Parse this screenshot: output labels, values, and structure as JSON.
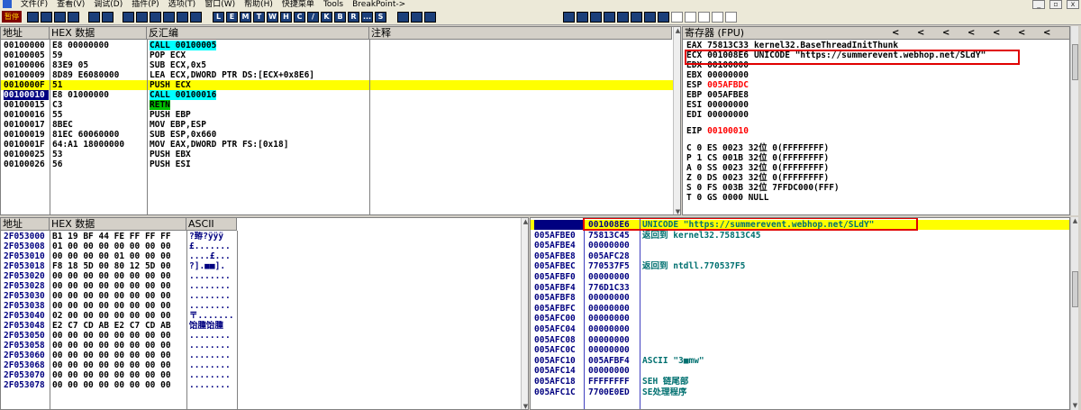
{
  "menu": [
    "暂停",
    "文件(F)",
    "查看(V)",
    "调试(D)",
    "插件(P)",
    "选项(T)",
    "窗口(W)",
    "帮助(H)",
    "快捷菜单",
    "Tools",
    "BreakPoint->"
  ],
  "window_controls": [
    "_",
    "▫",
    "x"
  ],
  "toolbar": {
    "pause_label": "暂停",
    "letters": [
      "L",
      "E",
      "M",
      "T",
      "W",
      "H",
      "C",
      "/",
      "K",
      "B",
      "R",
      "...",
      "S"
    ]
  },
  "disasm": {
    "headers": {
      "addr": "地址",
      "hex": "HEX 数据",
      "asm": "反汇编",
      "comment": "注释"
    },
    "rows": [
      {
        "addr": "00100000",
        "hex": "E8 00000000",
        "asm": "CALL 00100005",
        "kind": "call"
      },
      {
        "addr": "00100005",
        "hex": "59",
        "asm": "POP ECX",
        "kind": ""
      },
      {
        "addr": "00100006",
        "hex": "83E9 05",
        "asm": "SUB ECX,0x5",
        "kind": ""
      },
      {
        "addr": "00100009",
        "hex": "8D89 E6080000",
        "asm": "LEA ECX,DWORD PTR DS:[ECX+0x8E6]",
        "kind": ""
      },
      {
        "addr": "0010000F",
        "hex": "51",
        "asm": "PUSH ECX",
        "kind": "hl"
      },
      {
        "addr": "00100010",
        "hex": "E8 01000000",
        "asm": "CALL 00100016",
        "kind": "eip"
      },
      {
        "addr": "00100015",
        "hex": "C3",
        "asm": "RETN",
        "kind": "retn"
      },
      {
        "addr": "00100016",
        "hex": "55",
        "asm": "PUSH EBP",
        "kind": ""
      },
      {
        "addr": "00100017",
        "hex": "8BEC",
        "asm": "MOV EBP,ESP",
        "kind": ""
      },
      {
        "addr": "00100019",
        "hex": "81EC 60060000",
        "asm": "SUB ESP,0x660",
        "kind": ""
      },
      {
        "addr": "0010001F",
        "hex": "64:A1 18000000",
        "asm": "MOV EAX,DWORD PTR FS:[0x18]",
        "kind": ""
      },
      {
        "addr": "00100025",
        "hex": "53",
        "asm": "PUSH EBX",
        "kind": ""
      },
      {
        "addr": "00100026",
        "hex": "56",
        "asm": "PUSH ESI",
        "kind": ""
      }
    ]
  },
  "registers": {
    "header": "寄存器 (FPU)",
    "nav": [
      "<",
      "<",
      "<",
      "<",
      "<",
      "<",
      "<"
    ],
    "rows": [
      {
        "name": "EAX",
        "value": "75813C33",
        "note": "kernel32.BaseThreadInitThunk",
        "red": false
      },
      {
        "name": "ECX",
        "value": "001008E6",
        "note": "UNICODE \"https://summerevent.webhop.net/SLdY\"",
        "red": false
      },
      {
        "name": "EDX",
        "value": "00100000",
        "note": "",
        "red": false
      },
      {
        "name": "EBX",
        "value": "00000000",
        "note": "",
        "red": false
      },
      {
        "name": "ESP",
        "value": "005AFBDC",
        "note": "",
        "red": true
      },
      {
        "name": "EBP",
        "value": "005AFBE8",
        "note": "",
        "red": false
      },
      {
        "name": "ESI",
        "value": "00000000",
        "note": "",
        "red": false
      },
      {
        "name": "EDI",
        "value": "00000000",
        "note": "",
        "red": false
      },
      {
        "name": "EIP",
        "value": "00100010",
        "note": "",
        "red": true
      }
    ],
    "flags": [
      "C 0  ES 0023 32位 0(FFFFFFFF)",
      "P 1  CS 001B 32位 0(FFFFFFFF)",
      "A 0  SS 0023 32位 0(FFFFFFFF)",
      "Z 0  DS 0023 32位 0(FFFFFFFF)",
      "S 0  FS 003B 32位 7FFDC000(FFF)",
      "T 0  GS 0000 NULL"
    ]
  },
  "dump": {
    "headers": {
      "addr": "地址",
      "hex": "HEX 数据",
      "ascii": "ASCII"
    },
    "rows": [
      {
        "addr": "2F053000",
        "hex": "B1 19 BF 44 FE FF FF FF",
        "ascii": "?臶?ÿÿÿ"
      },
      {
        "addr": "2F053008",
        "hex": "01 00 00 00 00 00 00 00",
        "ascii": "£......."
      },
      {
        "addr": "2F053010",
        "hex": "00 00 00 00 01 00 00 00",
        "ascii": "....£..."
      },
      {
        "addr": "2F053018",
        "hex": "F8 18 5D 00 80 12 5D 00",
        "ascii": "?].■■]."
      },
      {
        "addr": "2F053020",
        "hex": "00 00 00 00 00 00 00 00",
        "ascii": "........"
      },
      {
        "addr": "2F053028",
        "hex": "00 00 00 00 00 00 00 00",
        "ascii": "........"
      },
      {
        "addr": "2F053030",
        "hex": "00 00 00 00 00 00 00 00",
        "ascii": "........"
      },
      {
        "addr": "2F053038",
        "hex": "00 00 00 00 00 00 00 00",
        "ascii": "........"
      },
      {
        "addr": "2F053040",
        "hex": "02 00 00 00 00 00 00 00",
        "ascii": "〒......."
      },
      {
        "addr": "2F053048",
        "hex": "E2 C7 CD AB E2 C7 CD AB",
        "ascii": "饴腫饴腫"
      },
      {
        "addr": "2F053050",
        "hex": "00 00 00 00 00 00 00 00",
        "ascii": "........"
      },
      {
        "addr": "2F053058",
        "hex": "00 00 00 00 00 00 00 00",
        "ascii": "........"
      },
      {
        "addr": "2F053060",
        "hex": "00 00 00 00 00 00 00 00",
        "ascii": "........"
      },
      {
        "addr": "2F053068",
        "hex": "00 00 00 00 00 00 00 00",
        "ascii": "........"
      },
      {
        "addr": "2F053070",
        "hex": "00 00 00 00 00 00 00 00",
        "ascii": "........"
      },
      {
        "addr": "2F053078",
        "hex": "00 00 00 00 00 00 00 00",
        "ascii": "........"
      }
    ]
  },
  "stack": {
    "rows": [
      {
        "addr": "005AFBDC",
        "value": "001008E6",
        "comment": "UNICODE \"https://summerevent.webhop.net/SLdY\"",
        "top": true
      },
      {
        "addr": "005AFBE0",
        "value": "75813C45",
        "comment": "返回到 kernel32.75813C45",
        "top": false
      },
      {
        "addr": "005AFBE4",
        "value": "00000000",
        "comment": "",
        "top": false
      },
      {
        "addr": "005AFBE8",
        "value": "005AFC28",
        "comment": "",
        "top": false
      },
      {
        "addr": "005AFBEC",
        "value": "770537F5",
        "comment": "返回到 ntdll.770537F5",
        "top": false
      },
      {
        "addr": "005AFBF0",
        "value": "00000000",
        "comment": "",
        "top": false
      },
      {
        "addr": "005AFBF4",
        "value": "776D1C33",
        "comment": "",
        "top": false
      },
      {
        "addr": "005AFBF8",
        "value": "00000000",
        "comment": "",
        "top": false
      },
      {
        "addr": "005AFBFC",
        "value": "00000000",
        "comment": "",
        "top": false
      },
      {
        "addr": "005AFC00",
        "value": "00000000",
        "comment": "",
        "top": false
      },
      {
        "addr": "005AFC04",
        "value": "00000000",
        "comment": "",
        "top": false
      },
      {
        "addr": "005AFC08",
        "value": "00000000",
        "comment": "",
        "top": false
      },
      {
        "addr": "005AFC0C",
        "value": "00000000",
        "comment": "",
        "top": false
      },
      {
        "addr": "005AFC10",
        "value": "005AFBF4",
        "comment": "ASCII \"3■mw\"",
        "top": false
      },
      {
        "addr": "005AFC14",
        "value": "00000000",
        "comment": "",
        "top": false
      },
      {
        "addr": "005AFC18",
        "value": "FFFFFFFF",
        "comment": "SEH 链尾部",
        "top": false
      },
      {
        "addr": "005AFC1C",
        "value": "7700E0ED",
        "comment": "SE处理程序",
        "top": false
      }
    ]
  },
  "colors": {
    "highlight": "#ffff00",
    "call": "#00ffff",
    "retn": "#00c000",
    "selection": "#000080",
    "annotation_box": "#e00000"
  }
}
